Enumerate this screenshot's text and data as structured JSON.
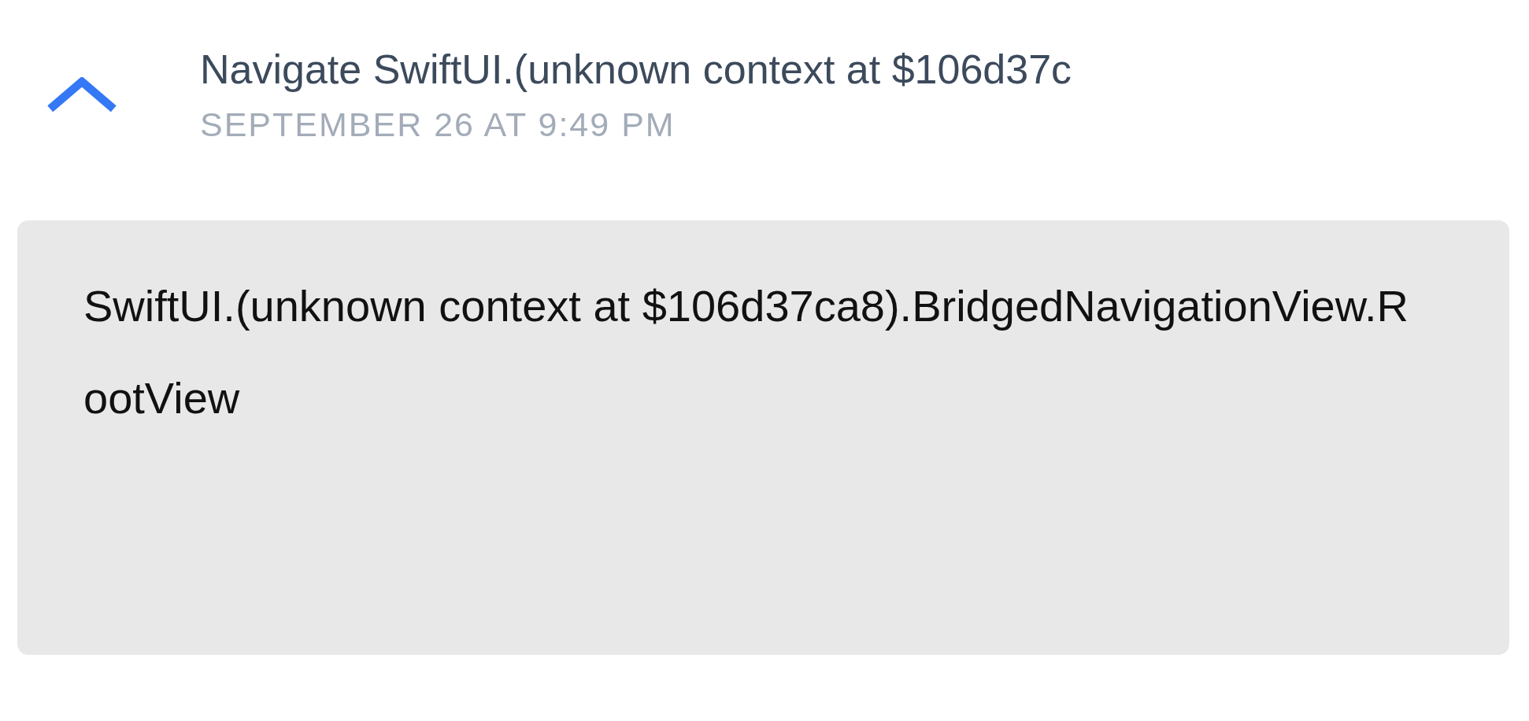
{
  "entry": {
    "expanded": true,
    "title": "Navigate SwiftUI.(unknown context at $106d37c",
    "timestamp": "SEPTEMBER 26 AT 9:49 PM"
  },
  "detail": {
    "text": "SwiftUI.(unknown context at $106d37ca8).BridgedNavigationView.RootView"
  }
}
